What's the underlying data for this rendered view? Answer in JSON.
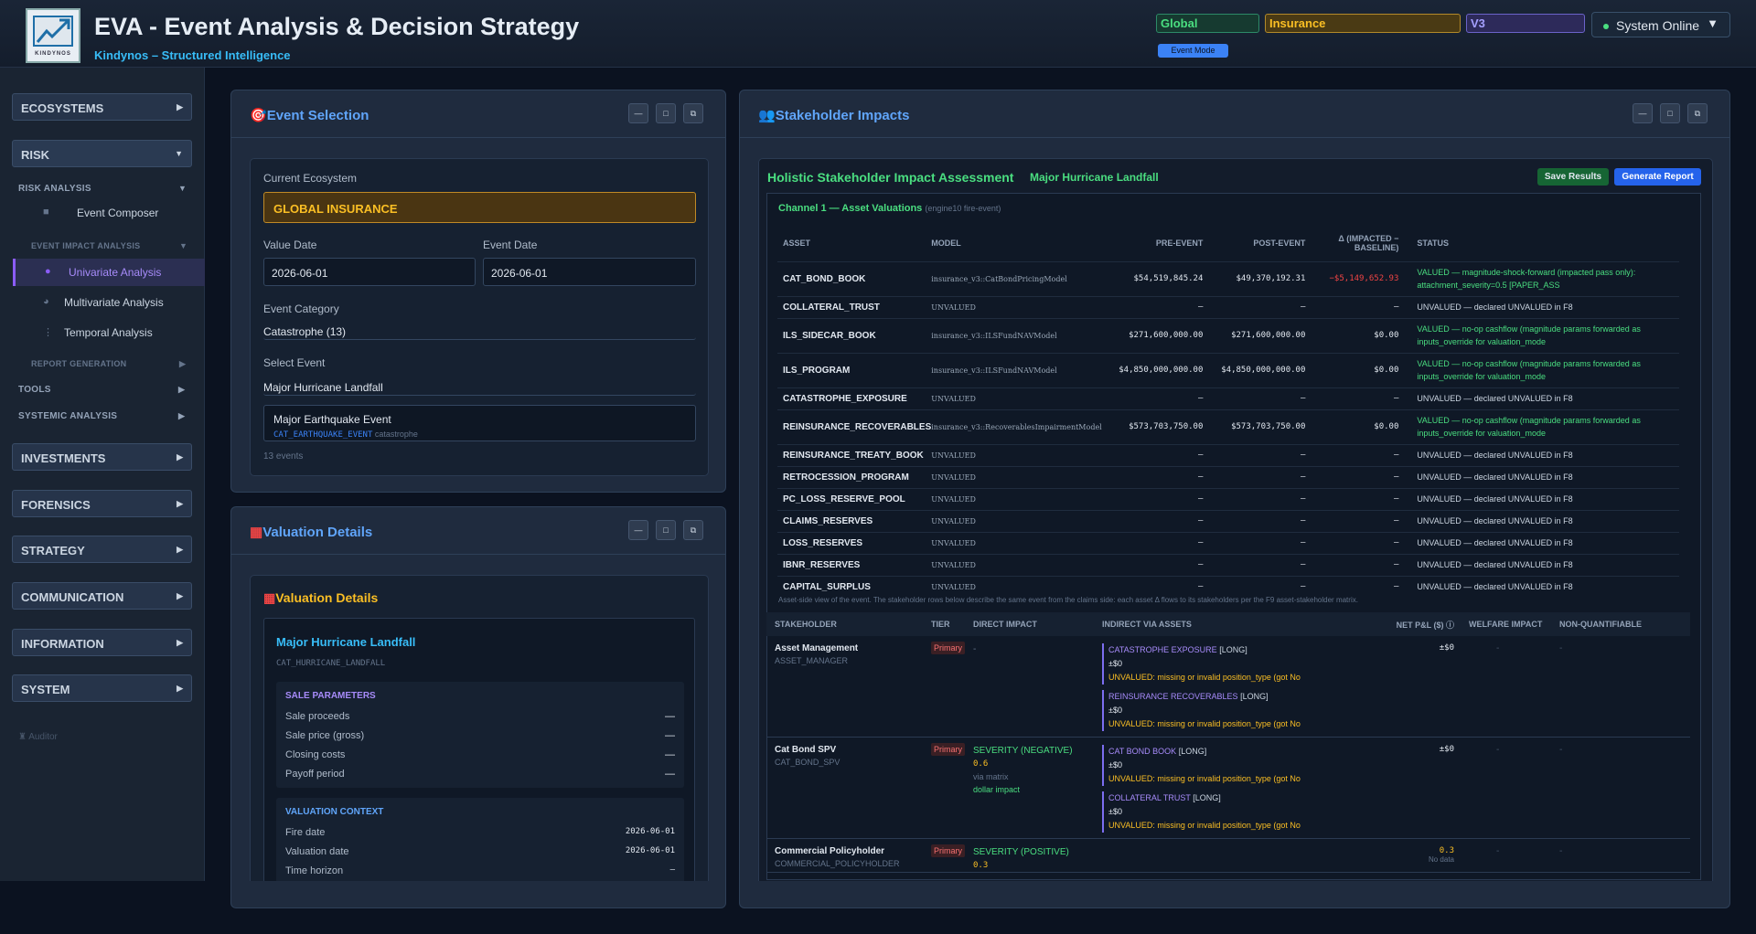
{
  "header": {
    "logo_text": "KINDYNOS",
    "title": "EVA - Event Analysis & Decision Strategy",
    "subtitle": "Kindynos – Structured Intelligence",
    "pill_global": "Global",
    "pill_insurance": "Insurance",
    "pill_v3": "V3",
    "event_mode": "Event Mode",
    "system_status": "System Online"
  },
  "sidebar": {
    "ecosystems": "ECOSYSTEMS",
    "risk": "RISK",
    "risk_analysis": "RISK ANALYSIS",
    "event_composer": "Event Composer",
    "event_impact_analysis": "EVENT IMPACT ANALYSIS",
    "univariate": "Univariate Analysis",
    "multivariate": "Multivariate Analysis",
    "temporal": "Temporal Analysis",
    "report_generation": "REPORT GENERATION",
    "tools": "TOOLS",
    "systemic": "SYSTEMIC ANALYSIS",
    "investments": "INVESTMENTS",
    "forensics": "FORENSICS",
    "strategy": "STRATEGY",
    "communication": "COMMUNICATION",
    "information": "INFORMATION",
    "system": "SYSTEM",
    "auditor": "Auditor"
  },
  "event_selection": {
    "title": "Event Selection",
    "current_ecosystem_label": "Current Ecosystem",
    "current_ecosystem": "GLOBAL INSURANCE",
    "value_date_label": "Value Date",
    "value_date": "2026-06-01",
    "event_date_label": "Event Date",
    "event_date": "2026-06-01",
    "category_label": "Event Category",
    "category": "Catastrophe (13)",
    "select_event_label": "Select Event",
    "selected_event": "Major Hurricane Landfall",
    "list_item_name": "Major Earthquake Event",
    "list_item_code": "CAT_EARTHQUAKE_EVENT",
    "list_item_type": "catastrophe",
    "count": "13 events"
  },
  "valuation": {
    "panel_title": "Valuation Details",
    "inner_title": "Valuation Details",
    "event_name": "Major Hurricane Landfall",
    "event_code": "CAT_HURRICANE_LANDFALL",
    "sale_params_title": "SALE PARAMETERS",
    "sale_params": [
      {
        "k": "Sale proceeds",
        "v": "—"
      },
      {
        "k": "Sale price (gross)",
        "v": "—"
      },
      {
        "k": "Closing costs",
        "v": "—"
      },
      {
        "k": "Payoff period",
        "v": "—"
      }
    ],
    "context_title": "VALUATION CONTEXT",
    "context": [
      {
        "k": "Fire date",
        "v": "2026-06-01"
      },
      {
        "k": "Valuation date",
        "v": "2026-06-01"
      },
      {
        "k": "Time horizon",
        "v": "—"
      }
    ]
  },
  "stakeholder": {
    "title": "Stakeholder Impacts",
    "assessment_title": "Holistic Stakeholder Impact Assessment",
    "event_name": "Major Hurricane Landfall",
    "save_button": "Save Results",
    "report_button": "Generate Report",
    "channel_title": "Channel 1 — Asset Valuations",
    "channel_sub": "(engine10 fire-event)",
    "columns": {
      "asset": "ASSET",
      "model": "MODEL",
      "pre": "PRE-EVENT",
      "post": "POST-EVENT",
      "delta": "Δ (IMPACTED − BASELINE)",
      "status": "STATUS"
    },
    "assets": [
      {
        "name": "CAT_BOND_BOOK",
        "model": "insurance_v3::CatBondPricingModel",
        "pre": "$54,519,845.24",
        "post": "$49,370,192.31",
        "delta": "−$5,149,652.93",
        "status": "VALUED — magnitude-shock-forward (impacted pass only): attachment_severity=0.5 [PAPER_ASS",
        "ok": true
      },
      {
        "name": "COLLATERAL_TRUST",
        "model": "UNVALUED",
        "pre": "—",
        "post": "—",
        "delta": "—",
        "status": "UNVALUED — declared UNVALUED in F8",
        "ok": false
      },
      {
        "name": "ILS_SIDECAR_BOOK",
        "model": "insurance_v3::ILSFundNAVModel",
        "pre": "$271,600,000.00",
        "post": "$271,600,000.00",
        "delta": "$0.00",
        "status": "VALUED — no-op cashflow (magnitude params forwarded as inputs_override for valuation_mode",
        "ok": true
      },
      {
        "name": "ILS_PROGRAM",
        "model": "insurance_v3::ILSFundNAVModel",
        "pre": "$4,850,000,000.00",
        "post": "$4,850,000,000.00",
        "delta": "$0.00",
        "status": "VALUED — no-op cashflow (magnitude params forwarded as inputs_override for valuation_mode",
        "ok": true
      },
      {
        "name": "CATASTROPHE_EXPOSURE",
        "model": "UNVALUED",
        "pre": "—",
        "post": "—",
        "delta": "—",
        "status": "UNVALUED — declared UNVALUED in F8",
        "ok": false
      },
      {
        "name": "REINSURANCE_RECOVERABLES",
        "model": "insurance_v3::RecoverablesImpairmentModel",
        "pre": "$573,703,750.00",
        "post": "$573,703,750.00",
        "delta": "$0.00",
        "status": "VALUED — no-op cashflow (magnitude params forwarded as inputs_override for valuation_mode",
        "ok": true
      },
      {
        "name": "REINSURANCE_TREATY_BOOK",
        "model": "UNVALUED",
        "pre": "—",
        "post": "—",
        "delta": "—",
        "status": "UNVALUED — declared UNVALUED in F8",
        "ok": false
      },
      {
        "name": "RETROCESSION_PROGRAM",
        "model": "UNVALUED",
        "pre": "—",
        "post": "—",
        "delta": "—",
        "status": "UNVALUED — declared UNVALUED in F8",
        "ok": false
      },
      {
        "name": "PC_LOSS_RESERVE_POOL",
        "model": "UNVALUED",
        "pre": "—",
        "post": "—",
        "delta": "—",
        "status": "UNVALUED — declared UNVALUED in F8",
        "ok": false
      },
      {
        "name": "CLAIMS_RESERVES",
        "model": "UNVALUED",
        "pre": "—",
        "post": "—",
        "delta": "—",
        "status": "UNVALUED — declared UNVALUED in F8",
        "ok": false
      },
      {
        "name": "LOSS_RESERVES",
        "model": "UNVALUED",
        "pre": "—",
        "post": "—",
        "delta": "—",
        "status": "UNVALUED — declared UNVALUED in F8",
        "ok": false
      },
      {
        "name": "IBNR_RESERVES",
        "model": "UNVALUED",
        "pre": "—",
        "post": "—",
        "delta": "—",
        "status": "UNVALUED — declared UNVALUED in F8",
        "ok": false
      },
      {
        "name": "CAPITAL_SURPLUS",
        "model": "UNVALUED",
        "pre": "—",
        "post": "—",
        "delta": "—",
        "status": "UNVALUED — declared UNVALUED in F8",
        "ok": false
      }
    ],
    "footnote": "Asset-side view of the event. The stakeholder rows below describe the same event from the claims side: each asset Δ flows to its stakeholders per the F9 asset-stakeholder matrix.",
    "s_columns": {
      "stakeholder": "STAKEHOLDER",
      "tier": "TIER",
      "direct": "DIRECT IMPACT",
      "indirect": "INDIRECT VIA ASSETS",
      "pnl": "NET P&L ($) ⓘ",
      "welfare": "WELFARE IMPACT",
      "nonq": "NON-QUANTIFIABLE"
    },
    "rows": [
      {
        "name": "Asset Management",
        "code": "ASSET_MANAGER",
        "tier": "Primary",
        "direct": "-",
        "direct_val": "",
        "direct_via": "",
        "direct_unit": "",
        "pnl": "±$0",
        "pnl_note": "",
        "welfare": "-",
        "nonq": "-",
        "assets": [
          {
            "n": "CATASTROPHE EXPOSURE",
            "t": "[LONG]",
            "v": "±$0",
            "w": "UNVALUED: missing or invalid position_type (got No"
          },
          {
            "n": "REINSURANCE RECOVERABLES",
            "t": "[LONG]",
            "v": "±$0",
            "w": "UNVALUED: missing or invalid position_type (got No"
          }
        ]
      },
      {
        "name": "Cat Bond SPV",
        "code": "CAT_BOND_SPV",
        "tier": "Primary",
        "direct": "SEVERITY (NEGATIVE)",
        "direct_val": "0.6",
        "direct_via": "via matrix",
        "direct_unit": "dollar impact",
        "pnl": "±$0",
        "pnl_note": "",
        "welfare": "-",
        "nonq": "-",
        "assets": [
          {
            "n": "CAT BOND BOOK",
            "t": "[LONG]",
            "v": "±$0",
            "w": "UNVALUED: missing or invalid position_type (got No"
          },
          {
            "n": "COLLATERAL TRUST",
            "t": "[LONG]",
            "v": "±$0",
            "w": "UNVALUED: missing or invalid position_type (got No"
          }
        ]
      },
      {
        "name": "Commercial Policyholder",
        "code": "COMMERCIAL_POLICYHOLDER",
        "tier": "Primary",
        "direct": "SEVERITY (POSITIVE)",
        "direct_val": "0.3",
        "direct_via": "",
        "direct_unit": "",
        "pnl": "0.3",
        "pnl_note": "No data",
        "welfare": "-",
        "nonq": "-",
        "assets": []
      }
    ]
  }
}
